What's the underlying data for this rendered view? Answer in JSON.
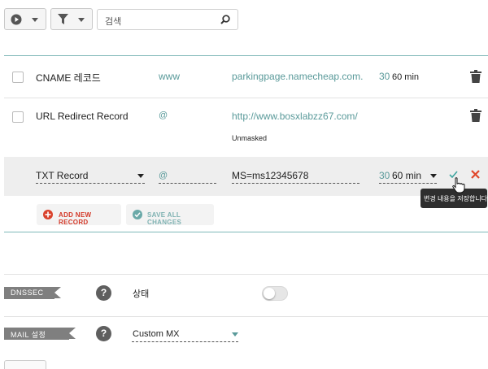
{
  "toolbar": {
    "run_icon": "play-circle-icon",
    "filter_icon": "filter-icon",
    "search_placeholder": "검색",
    "search_icon": "magnifier-icon"
  },
  "records": [
    {
      "type": "CNAME 레코드",
      "host": "www",
      "value": "parkingpage.namecheap.com.",
      "ttl_prefix": "30",
      "ttl": "60 min"
    },
    {
      "type": "URL Redirect Record",
      "host": "@",
      "value": "http://www.bosxlabzz67.com/",
      "sub_label": "Unmasked"
    }
  ],
  "edit_row": {
    "type": "TXT Record",
    "host": "@",
    "value": "MS=ms12345678",
    "ttl_prefix": "30",
    "ttl": "60 min"
  },
  "tooltip": "변경 내용을 저장합니다.",
  "actions": {
    "add_new": "ADD NEW RECORD",
    "save_all": "SAVE ALL CHANGES"
  },
  "dnssec": {
    "label": "DNSSEC",
    "help": "?",
    "status_label": "상태",
    "enabled": false
  },
  "mail": {
    "label": "MAIL 설정",
    "help": "?",
    "selected": "Custom MX"
  },
  "colors": {
    "accent_teal": "#5a9a9a",
    "delete_red": "#e0472a",
    "confirm_teal": "#3ea5a0",
    "ribbon_grey": "#7f7f7f"
  }
}
